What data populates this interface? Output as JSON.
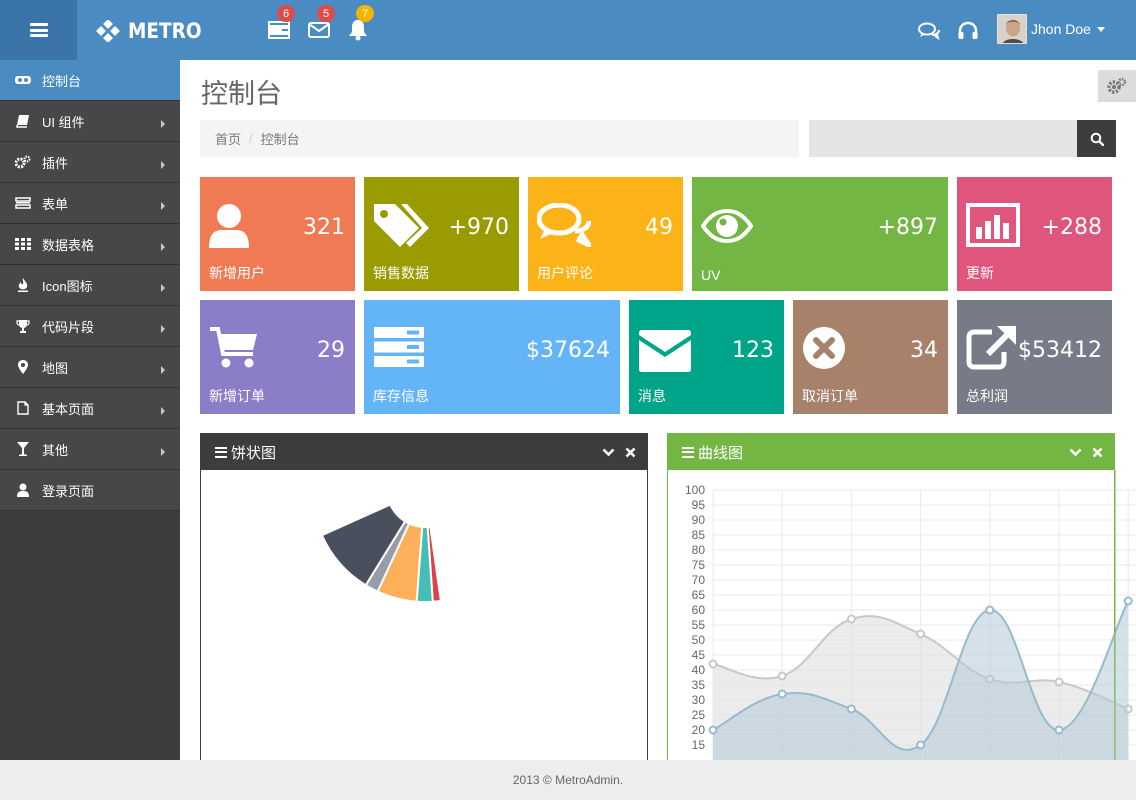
{
  "brand": {
    "name": "METRO"
  },
  "notifications": [
    {
      "icon": "tasks-icon",
      "count": "6",
      "color": "#e04b4a"
    },
    {
      "icon": "envelope-icon",
      "count": "5",
      "color": "#e04b4a"
    },
    {
      "icon": "bell-icon",
      "count": "7",
      "color": "#f4b400"
    }
  ],
  "user": {
    "name": "Jhon Doe"
  },
  "sidebar": {
    "items": [
      {
        "label": "控制台",
        "icon": "dashboard-icon",
        "active": true
      },
      {
        "label": "UI 组件",
        "icon": "book-icon"
      },
      {
        "label": "插件",
        "icon": "cogs-icon"
      },
      {
        "label": "表单",
        "icon": "form-icon"
      },
      {
        "label": "数据表格",
        "icon": "grid-icon"
      },
      {
        "label": "Icon图标",
        "icon": "fire-icon"
      },
      {
        "label": "代码片段",
        "icon": "trophy-icon"
      },
      {
        "label": "地图",
        "icon": "map-marker-icon"
      },
      {
        "label": "基本页面",
        "icon": "file-icon"
      },
      {
        "label": "其他",
        "icon": "glass-icon"
      },
      {
        "label": "登录页面",
        "icon": "user-icon"
      }
    ]
  },
  "page": {
    "title": "控制台",
    "breadcrumb": [
      "首页",
      "控制台"
    ],
    "search_placeholder": ""
  },
  "tiles": [
    {
      "value": "321",
      "label": "新增用户",
      "color": "#f07a53",
      "icon": "user-icon"
    },
    {
      "value": "+970",
      "label": "销售数据",
      "color": "#9a9b00",
      "icon": "tags-icon"
    },
    {
      "value": "49",
      "label": "用户评论",
      "color": "#fcb317",
      "icon": "comments-icon"
    },
    {
      "value": "+897",
      "label": "UV",
      "color": "#74b644",
      "icon": "eye-icon"
    },
    {
      "value": "+288",
      "label": "更新",
      "color": "#e0557b",
      "icon": "bar-chart-icon"
    },
    {
      "value": "29",
      "label": "新增订单",
      "color": "#8b7dc8",
      "icon": "shopping-cart-icon"
    },
    {
      "value": "$37624",
      "label": "库存信息",
      "color": "#63b5f8",
      "icon": "server-icon"
    },
    {
      "value": "123",
      "label": "消息",
      "color": "#00a488",
      "icon": "envelope-icon"
    },
    {
      "value": "34",
      "label": "取消订单",
      "color": "#a7816a",
      "icon": "times-circle-icon"
    },
    {
      "value": "$53412",
      "label": "总利润",
      "color": "#767b87",
      "icon": "external-link-icon"
    }
  ],
  "panels": {
    "pie": {
      "title": "饼状图",
      "color": "#3d3d3d"
    },
    "line": {
      "title": "曲线图",
      "color": "#74b644"
    }
  },
  "chart_data": [
    {
      "type": "pie",
      "slices": [
        {
          "value": 3,
          "color": "#e0404a"
        },
        {
          "value": 6,
          "color": "#45bfb5"
        },
        {
          "value": 15,
          "color": "#fcb05a"
        },
        {
          "value": 5,
          "color": "#969ca9"
        },
        {
          "value": 25,
          "color": "#4a4f5e"
        }
      ]
    },
    {
      "type": "area",
      "title": "",
      "xlabel": "",
      "ylabel": "",
      "ylim": [
        0,
        100
      ],
      "grid": true,
      "y_ticks": [
        100,
        95,
        90,
        85,
        80,
        75,
        70,
        65,
        60,
        55,
        50,
        45,
        40,
        35,
        30,
        25,
        20,
        15
      ],
      "series": [
        {
          "values": [
            42,
            38,
            57,
            52,
            37,
            36,
            27
          ],
          "fill": "#dcdcdc",
          "stroke": "#c8c8c8"
        },
        {
          "values": [
            20,
            32,
            27,
            15,
            60,
            20,
            63
          ],
          "fill": "#b4cbd9",
          "stroke": "#97bbcd"
        }
      ]
    }
  ],
  "footer": {
    "text": "2013 © MetroAdmin."
  }
}
